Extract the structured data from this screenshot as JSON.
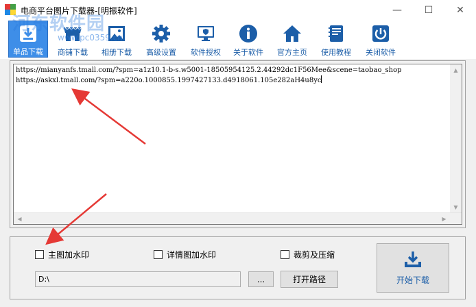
{
  "window": {
    "title": "电商平台图片下载器-[明振软件]",
    "min_glyph": "—",
    "max_glyph": "☐",
    "close_glyph": "✕",
    "logo_colors": [
      "#e53935",
      "#43a047",
      "#1e88e5",
      "#fdd835"
    ]
  },
  "watermark": {
    "text": "河东软件园",
    "url": "www.pc0359.cn"
  },
  "toolbar": {
    "items": [
      {
        "label": "单品下载",
        "icon": "download-box-icon",
        "active": true
      },
      {
        "label": "商铺下载",
        "icon": "shop-icon",
        "active": false
      },
      {
        "label": "相册下载",
        "icon": "picture-icon",
        "active": false
      },
      {
        "label": "高级设置",
        "icon": "gear-icon",
        "active": false
      },
      {
        "label": "软件授权",
        "icon": "monitor-shield-icon",
        "active": false
      },
      {
        "label": "关于软件",
        "icon": "info-icon",
        "active": false
      },
      {
        "label": "官方主页",
        "icon": "home-icon",
        "active": false
      },
      {
        "label": "使用教程",
        "icon": "book-icon",
        "active": false
      },
      {
        "label": "关闭软件",
        "icon": "power-icon",
        "active": false
      }
    ],
    "icon_color": "#1c5ea8",
    "active_color": "#3e8ee8"
  },
  "url_box": {
    "lines": [
      "https://mianyanfs.tmall.com/?spm=a1z10.1-b-s.w5001-18505954125.2.44292dc1F56Mee&scene=taobao_shop",
      "https://askxl.tmall.com/?spm=a220o.1000855.1997427133.d4918061.105e282aH4u8yc"
    ]
  },
  "options": {
    "main_watermark": "主图加水印",
    "detail_watermark": "详情图加水印",
    "crop_compress": "裁剪及压缩",
    "main_watermark_checked": false,
    "detail_watermark_checked": false,
    "crop_compress_checked": false
  },
  "path": {
    "value": "D:\\",
    "browse_label": "...",
    "open_label": "打开路径"
  },
  "start": {
    "label": "开始下载",
    "icon": "download-tray-icon"
  },
  "annotation_color": "#e53935"
}
